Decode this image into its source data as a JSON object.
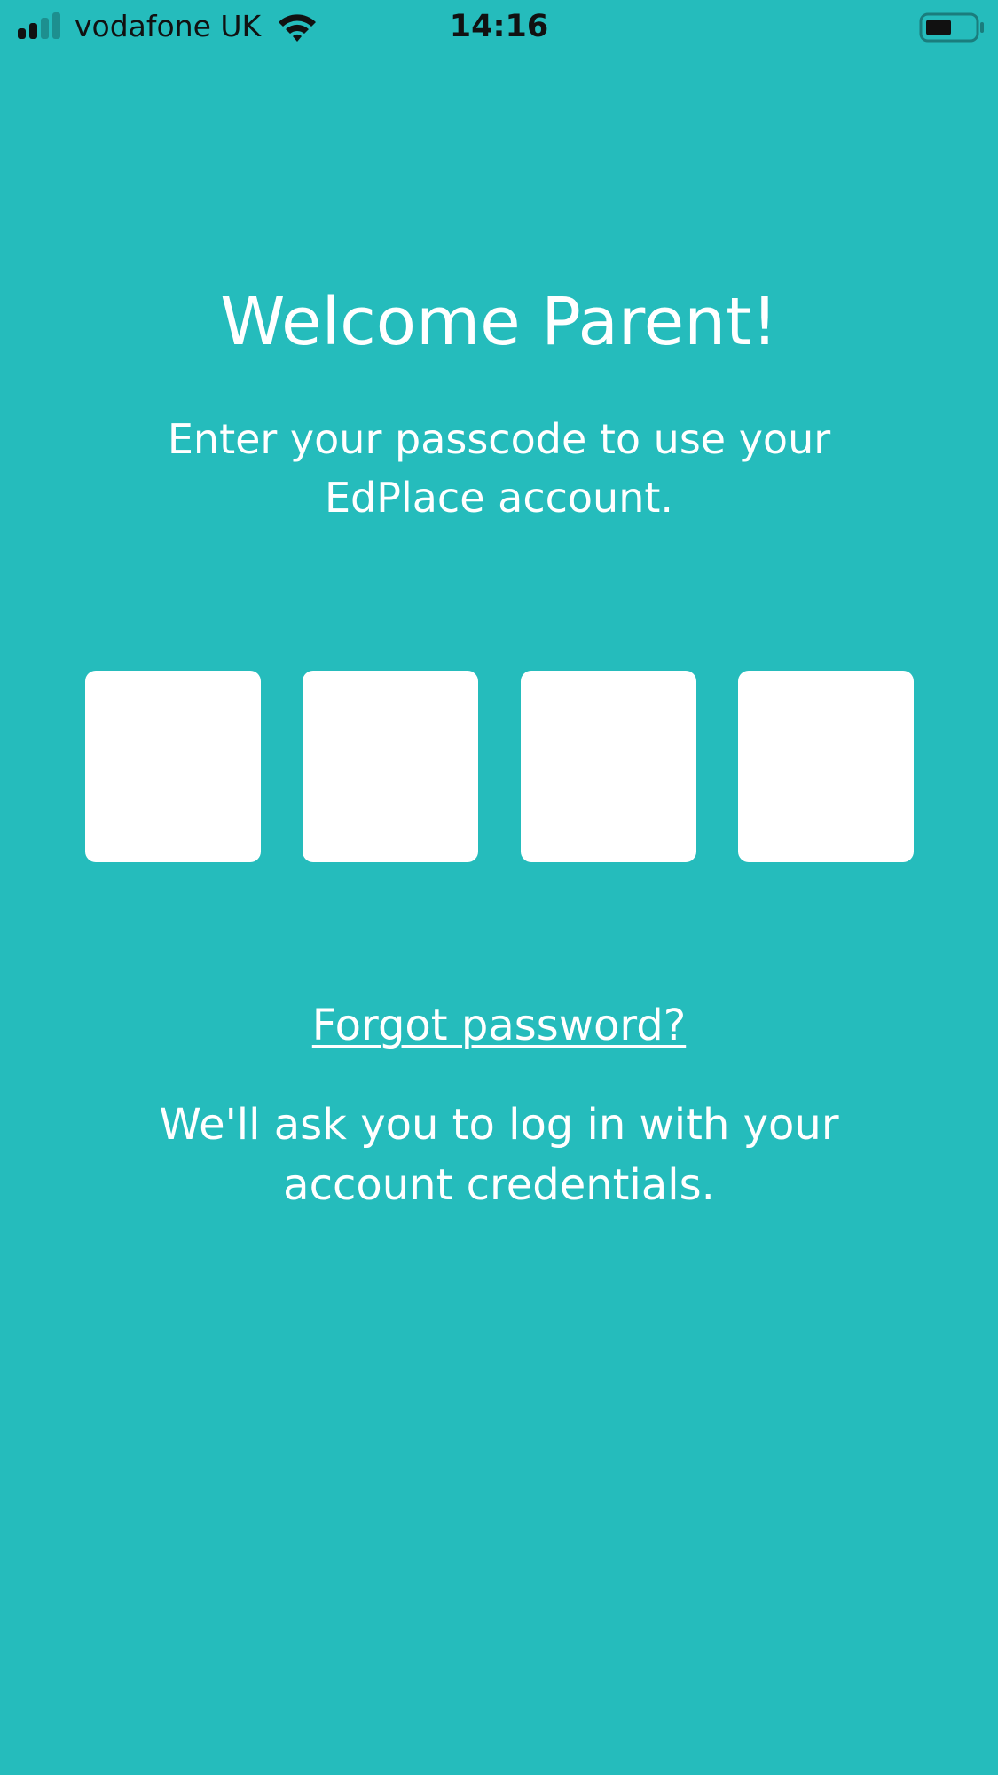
{
  "status_bar": {
    "carrier": "vodafone UK",
    "time": "14:16",
    "icons": [
      "signal-icon",
      "wifi-icon",
      "battery-icon"
    ]
  },
  "main": {
    "title": "Welcome Parent!",
    "subtitle": "Enter your passcode to use your EdPlace account.",
    "passcode_digits": [
      "",
      "",
      "",
      ""
    ],
    "forgot_link": "Forgot password?",
    "note": "We'll ask you to log in with your account credentials."
  },
  "colors": {
    "background": "#25bcbc",
    "text": "#ffffff",
    "input_fill": "#ffffff"
  }
}
